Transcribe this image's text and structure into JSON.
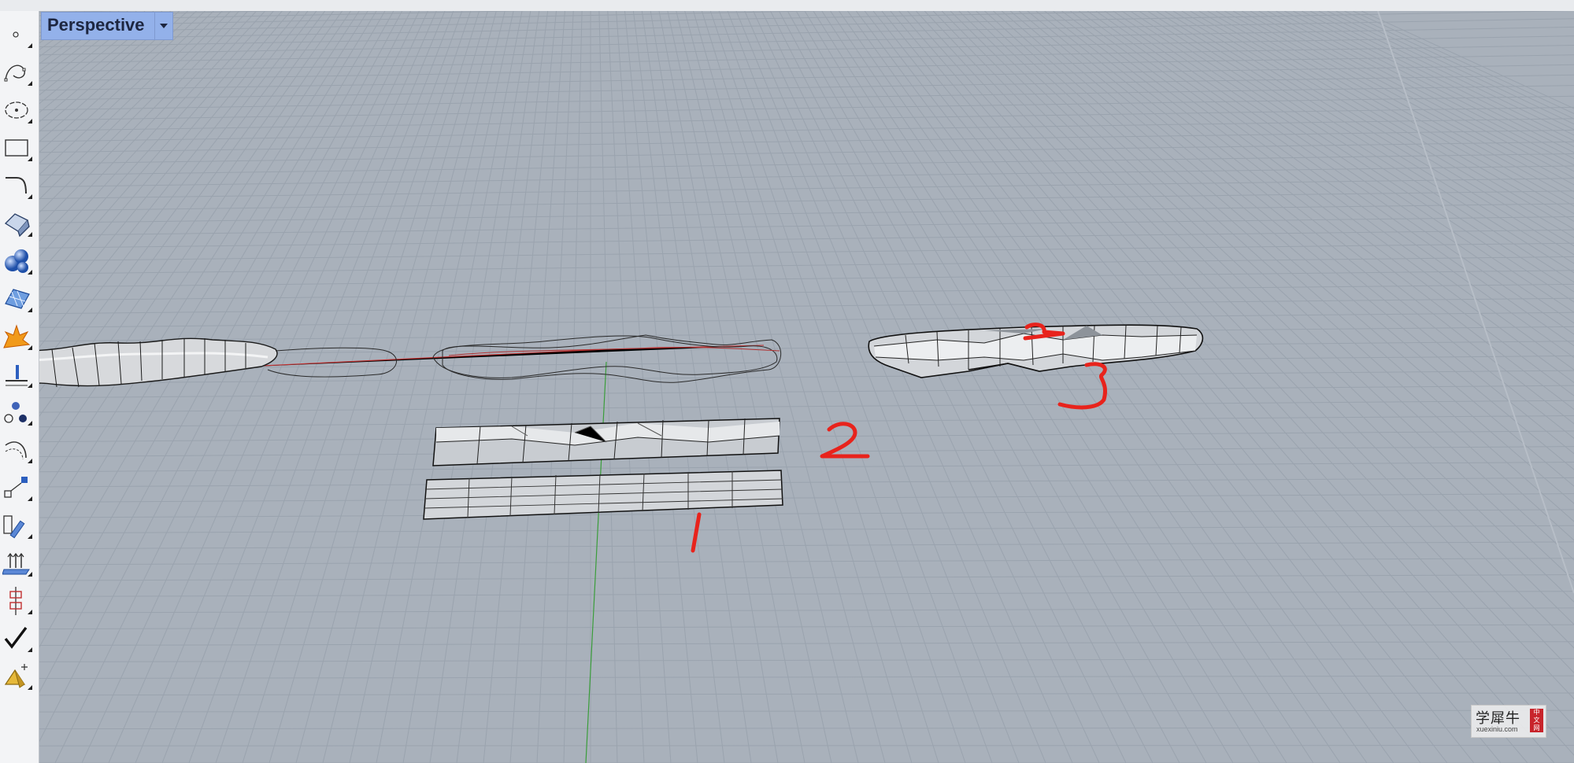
{
  "viewport": {
    "title": "Perspective",
    "background_color": "#a9b1bb",
    "grid_color": "#9aa3ae",
    "axis_green": "#3a9d3a",
    "axis_red": "#c03030"
  },
  "annotations": {
    "color": "#e8231c",
    "label_1": "1",
    "label_2": "2",
    "label_3_top": "2",
    "label_3": "3"
  },
  "toolbar": {
    "tools": [
      {
        "icon": "point-icon"
      },
      {
        "icon": "curve-icon"
      },
      {
        "icon": "circle-icon"
      },
      {
        "icon": "rectangle-icon"
      },
      {
        "icon": "fillet-curve-icon"
      },
      {
        "icon": "surface-icon"
      },
      {
        "icon": "solid-spheres-icon"
      },
      {
        "icon": "mesh-icon"
      },
      {
        "icon": "explode-icon"
      },
      {
        "icon": "dimension-icon"
      },
      {
        "icon": "points-on-icon"
      },
      {
        "icon": "arc-edit-icon"
      },
      {
        "icon": "scale-icon"
      },
      {
        "icon": "transform-icon"
      },
      {
        "icon": "array-icon"
      },
      {
        "icon": "align-icon"
      },
      {
        "icon": "check-icon"
      },
      {
        "icon": "render-icon"
      }
    ]
  },
  "watermark": {
    "main": "学犀牛",
    "sub": "xuexiniu.com",
    "seal": "中文网"
  }
}
